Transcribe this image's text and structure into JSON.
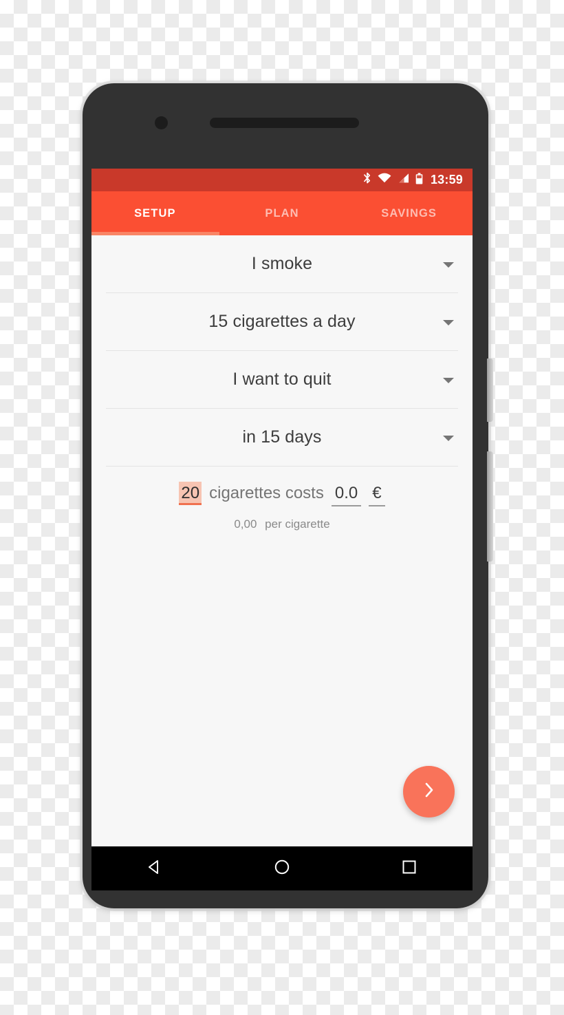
{
  "device": {
    "name": "android-phone-mockup",
    "camera_icon": "camera-dot",
    "earpiece_icon": "earpiece-speaker"
  },
  "status_bar": {
    "bluetooth_icon": "bluetooth-icon",
    "wifi_icon": "wifi-icon",
    "cellular_icon": "cellular-signal-icon",
    "battery_icon": "battery-icon",
    "time": "13:59",
    "background_color": "#c9392a"
  },
  "tabs": {
    "accent_color": "#fb4f33",
    "indicator_color": "#f98566",
    "items": [
      {
        "label": "SETUP",
        "active": true
      },
      {
        "label": "PLAN",
        "active": false
      },
      {
        "label": "SAVINGS",
        "active": false
      }
    ]
  },
  "form": {
    "fields": [
      {
        "label": "I smoke"
      },
      {
        "label": "15 cigarettes a day"
      },
      {
        "label": "I want to quit"
      },
      {
        "label": "in 15 days"
      }
    ]
  },
  "cost": {
    "quantity": "20",
    "quantity_highlight_color": "#f7c4b2",
    "quantity_underline_color": "#f0714f",
    "middle_text": "cigarettes costs",
    "price": "0.0",
    "currency": "€",
    "per_unit_value": "0,00",
    "per_unit_label": "per cigarette"
  },
  "fab": {
    "icon": "chevron-right-icon",
    "color": "#f9735a"
  },
  "nav_bar": {
    "back_icon": "back-triangle-icon",
    "home_icon": "home-circle-icon",
    "recents_icon": "recents-square-icon"
  }
}
